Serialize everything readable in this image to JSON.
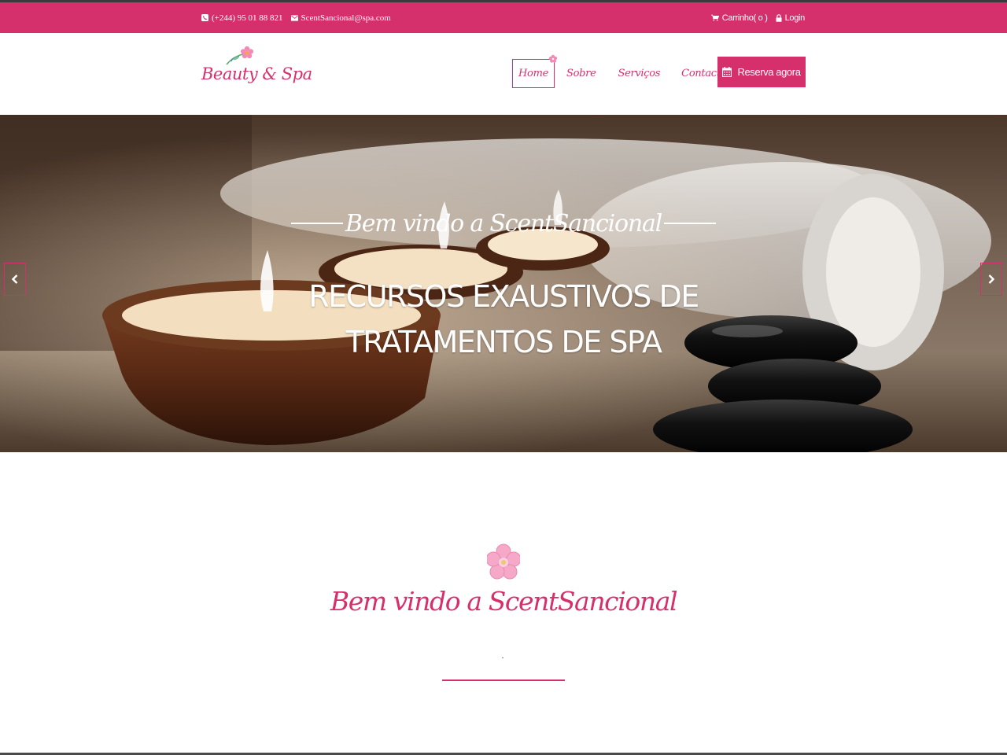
{
  "topbar": {
    "phone": "(+244) 95 01 88 821",
    "email": "ScentSancional@spa.com",
    "cart": "Carrinho( o )",
    "login": "Login"
  },
  "header": {
    "logo_text": "Beauty & Spa",
    "nav": {
      "home": "Home",
      "sobre": "Sobre",
      "servicos": "Serviços",
      "contactos": "Contactos"
    },
    "reserve_label": "Reserva agora"
  },
  "hero": {
    "subtitle": "Bem vindo a ScentSancional",
    "title_line1": "RECURSOS EXAUSTIVOS DE",
    "title_line2": "TRATAMENTOS DE SPA"
  },
  "welcome": {
    "title": "Bem vindo a ScentSancional"
  },
  "colors": {
    "brand": "#d6306c",
    "text_light": "#ffffff"
  },
  "icons": [
    "phone-icon",
    "mail-icon",
    "cart-icon",
    "lock-icon",
    "calendar-icon",
    "flower-icon",
    "chevron-left-icon",
    "chevron-right-icon"
  ]
}
